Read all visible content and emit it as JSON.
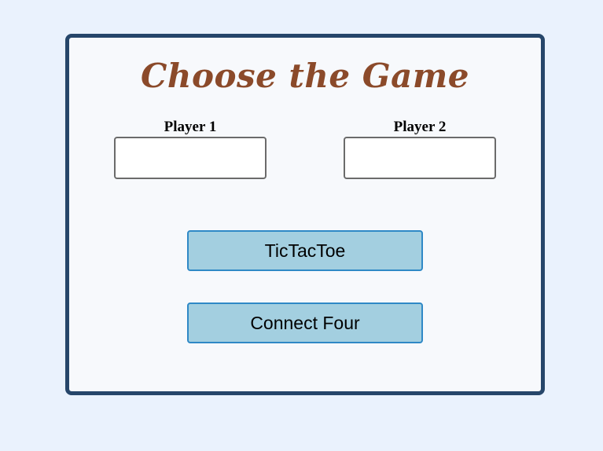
{
  "title": "Choose the Game",
  "players": {
    "player1": {
      "label": "Player 1",
      "value": ""
    },
    "player2": {
      "label": "Player 2",
      "value": ""
    }
  },
  "buttons": {
    "tictactoe": "TicTacToe",
    "connect_four": "Connect Four"
  }
}
